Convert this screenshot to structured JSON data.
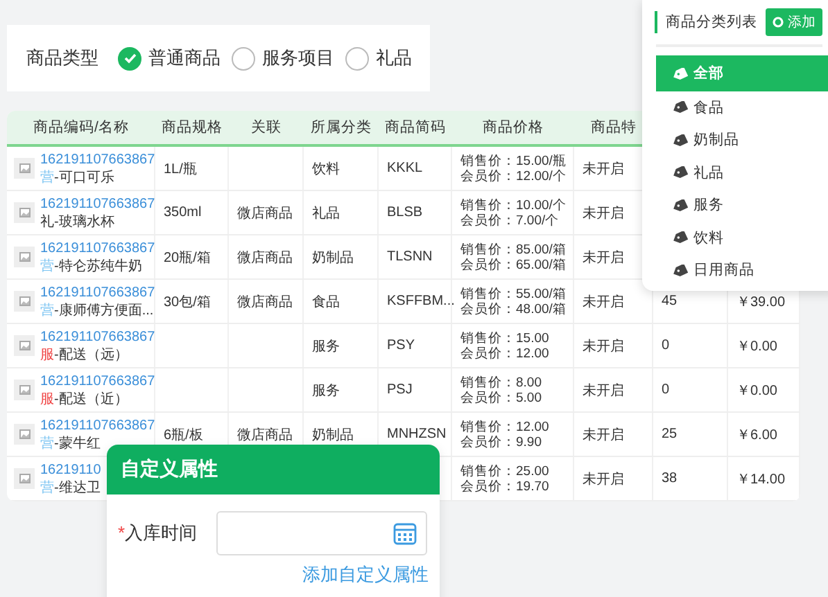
{
  "type_filter": {
    "label": "商品类型",
    "options": [
      {
        "label": "普通商品",
        "selected": true
      },
      {
        "label": "服务项目",
        "selected": false
      },
      {
        "label": "礼品",
        "selected": false
      }
    ]
  },
  "table": {
    "columns": [
      "商品编码/名称",
      "商品规格",
      "关联",
      "所属分类",
      "商品简码",
      "商品价格",
      "商品特"
    ],
    "rows": [
      {
        "code": "162191107663867",
        "tag": "营",
        "color": "#7cc4f2",
        "name": "-可口可乐",
        "spec": "1L/瓶",
        "category": "饮料",
        "short_code": "KKKL",
        "prices": [
          "销售价：15.00/瓶",
          "会员价：12.00/个"
        ],
        "special": "未开启"
      },
      {
        "code": "162191107663867",
        "tag": "礼",
        "color": "#333333",
        "name": "-玻璃水杯",
        "spec": "350ml",
        "relation": "微店商品",
        "category": "礼品",
        "short_code": "BLSB",
        "prices": [
          "销售价：10.00/个",
          "会员价：7.00/个"
        ],
        "special": "未开启"
      },
      {
        "code": "162191107663867",
        "tag": "营",
        "color": "#7cc4f2",
        "name": "-特仑苏纯牛奶",
        "spec": "20瓶/箱",
        "relation": "微店商品",
        "category": "奶制品",
        "short_code": "TLSNN",
        "prices": [
          "销售价：85.00/箱",
          "会员价：65.00/箱"
        ],
        "special": "未开启"
      },
      {
        "code": "162191107663867",
        "tag": "营",
        "color": "#7cc4f2",
        "name": "-康师傅方便面...",
        "spec": "30包/箱",
        "relation": "微店商品",
        "category": "食品",
        "short_code": "KSFFBM...",
        "prices": [
          "销售价：55.00/箱",
          "会员价：48.00/箱"
        ],
        "special": "未开启",
        "column_8": "45",
        "column_9": "￥39.00"
      },
      {
        "code": "162191107663867",
        "tag": "服",
        "color": "#f04848",
        "name": "-配送（远）",
        "category": "服务",
        "short_code": "PSY",
        "prices": [
          "销售价：15.00",
          "会员价：12.00"
        ],
        "special": "未开启",
        "column_8": "0",
        "column_9": "￥0.00"
      },
      {
        "code": "162191107663867",
        "tag": "服",
        "color": "#f04848",
        "name": "-配送（近）",
        "category": "服务",
        "short_code": "PSJ",
        "prices": [
          "销售价：8.00",
          "会员价：5.00"
        ],
        "special": "未开启",
        "column_8": "0",
        "column_9": "￥0.00"
      },
      {
        "code": "162191107663867",
        "tag": "营",
        "color": "#7cc4f2",
        "name": "-蒙牛红",
        "spec": "6瓶/板",
        "relation": "微店商品",
        "category": "奶制品",
        "short_code": "MNHZSN",
        "prices": [
          "销售价：12.00",
          "会员价：9.90"
        ],
        "special": "未开启",
        "column_8": "25",
        "column_9": "￥6.00"
      },
      {
        "code": "16219110",
        "tag": "营",
        "color": "#7cc4f2",
        "name": "-维达卫",
        "prices": [
          "销售价：25.00",
          "会员价：19.70"
        ],
        "special": "未开启",
        "column_8": "38",
        "column_9": "￥14.00"
      }
    ]
  },
  "category_panel": {
    "title": "商品分类列表",
    "add_button": "添加",
    "items": [
      {
        "label": "全部",
        "selected": true
      },
      {
        "label": "食品",
        "selected": false
      },
      {
        "label": "奶制品",
        "selected": false
      },
      {
        "label": "礼品",
        "selected": false
      },
      {
        "label": "服务",
        "selected": false
      },
      {
        "label": "饮料",
        "selected": false
      },
      {
        "label": "日用商品",
        "selected": false
      }
    ]
  },
  "dialog": {
    "title": "自定义属性",
    "field_label": "入库时间",
    "required_mark": "*",
    "add_link": "添加自定义属性"
  }
}
